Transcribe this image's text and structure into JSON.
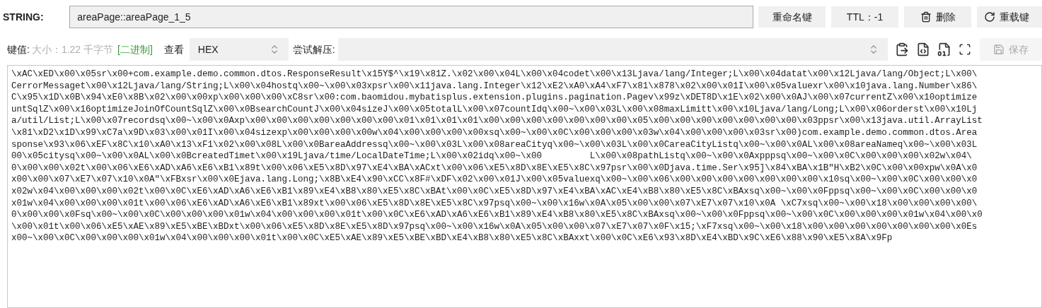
{
  "key_type": "STRING:",
  "key_name": "areaPage::areaPage_1_5",
  "buttons": [
    {
      "kind": "rename",
      "label": "重命名键"
    },
    {
      "kind": "ttl",
      "label": "TTL：-1"
    },
    {
      "kind": "delete",
      "label": "删除"
    },
    {
      "kind": "reload",
      "label": "重载键"
    }
  ],
  "value_bar": {
    "label": "键值:",
    "size": "大小：1.22 千字节",
    "format": "[二进制]",
    "view_label": "查看",
    "view_mode": "HEX",
    "decompress_label": "尝试解压:",
    "save": {
      "label": "保存",
      "disabled": true
    }
  },
  "value_lines": [
    "\\xAC\\xED\\x00\\x05sr\\x00+com.example.demo.common.dtos.ResponseResult\\x15Y$^\\x19\\x81Z.\\x02\\x00\\x04L\\x00\\x04codet\\x00\\x13Ljava/lang/Integer;L\\x00\\x04datat\\x00\\x12Ljava/lang/Object;L\\x00\\",
    "CerrorMessaget\\x00\\x12Ljava/lang/String;L\\x00\\x04hostq\\x00~\\x00\\x03xpsr\\x00\\x11java.lang.Integer\\x12\\xE2\\xA0\\xA4\\xF7\\x81\\x878\\x02\\x00\\x01I\\x00\\x05valuexr\\x00\\x10java.lang.Number\\x86\\",
    "C\\x95\\x1D\\x0B\\x94\\xE0\\x8B\\x02\\x00\\x00xp\\x00\\x00\\x00\\xC8sr\\x00:com.baomidou.mybatisplus.extension.plugins.pagination.Pagev\\x99z\\xDET8D\\x1E\\x02\\x00\\x0AJ\\x00\\x07currentZ\\x00\\x10optimize",
    "untSqlZ\\x00\\x16optimizeJoinOfCountSqlZ\\x00\\x0BsearchCountJ\\x00\\x04sizeJ\\x00\\x05totalL\\x00\\x07countIdq\\x00~\\x00\\x03L\\x00\\x08maxLimitt\\x00\\x10Ljava/lang/Long;L\\x00\\x06orderst\\x00\\x10Lj",
    "a/util/List;L\\x00\\x07recordsq\\x00~\\x00\\x0Axp\\x00\\x00\\x00\\x00\\x00\\x00\\x00\\x01\\x01\\x01\\x01\\x00\\x00\\x00\\x00\\x00\\x00\\x00\\x05\\x00\\x00\\x00\\x00\\x00\\x00\\x00\\x03ppsr\\x00\\x13java.util.ArrayList",
    "\\x81\\xD2\\x1D\\x99\\xC7a\\x9D\\x03\\x00\\x01I\\x00\\x04sizexp\\x00\\x00\\x00\\x00w\\x04\\x00\\x00\\x00\\x00xsq\\x00~\\x00\\x0C\\x00\\x00\\x00\\x03w\\x04\\x00\\x00\\x00\\x03sr\\x00)com.example.demo.common.dtos.Area",
    "sponse\\x93\\x06\\xEF\\x8C\\x10\\xA0\\x13\\xF1\\x02\\x00\\x08L\\x00\\x0BareaAddressq\\x00~\\x00\\x03L\\x00\\x08areaCityq\\x00~\\x00\\x03L\\x00\\x0CareaCityListq\\x00~\\x00\\x0AL\\x00\\x08areaNameq\\x00~\\x00\\x03L",
    "00\\x05citysq\\x00~\\x00\\x0AL\\x00\\x0BcreatedTimet\\x00\\x19Ljava/time/LocalDateTime;L\\x00\\x02idq\\x00~\\x00         L\\x00\\x08pathListq\\x00~\\x00\\x0Axpppsq\\x00~\\x00\\x0C\\x00\\x00\\x00\\x02w\\x04\\",
    "0\\x00\\x00\\x02t\\x00\\x06\\xE6\\xAD\\xA6\\xE6\\xB1\\x89t\\x00\\x06\\xE5\\x8D\\x97\\xE4\\xBA\\xACxt\\x00\\x06\\xE5\\x8D\\x8E\\xE5\\x8C\\x97psr\\x00\\x0Djava.time.Ser\\x95]\\x84\\xBA\\x1B\"H\\xB2\\x0C\\x00\\x00xpw\\x0A\\x0",
    "x00\\x00\\x07\\xE7\\x07\\x10\\x0A\"\\xFBxsr\\x00\\x0Ejava.lang.Long;\\x8B\\xE4\\x90\\xCC\\x8F#\\xDF\\x02\\x00\\x01J\\x00\\x05valuexq\\x00~\\x00\\x06\\x00\\x00\\x00\\x00\\x00\\x00\\x00\\x10sq\\x00~\\x00\\x0C\\x00\\x00\\x0",
    "x02w\\x04\\x00\\x00\\x00\\x02t\\x00\\x0C\\xE6\\xAD\\xA6\\xE6\\xB1\\x89\\xE4\\xB8\\x80\\xE5\\x8C\\xBAt\\x00\\x0C\\xE5\\x8D\\x97\\xE4\\xBA\\xAC\\xE4\\xB8\\x80\\xE5\\x8C\\xBAxsq\\x00~\\x00\\x0Fppsq\\x00~\\x00\\x0C\\x00\\x00\\x0",
    "x01w\\x04\\x00\\x00\\x00\\x01t\\x00\\x06\\xE6\\xAD\\xA6\\xE6\\xB1\\x89xt\\x00\\x06\\xE5\\x8D\\x8E\\xE5\\x8C\\x97psq\\x00~\\x00\\x16w\\x0A\\x05\\x00\\x00\\x07\\xE7\\x07\\x10\\x0A \\xC7xsq\\x00~\\x00\\x18\\x00\\x00\\x00\\x00\\",
    "0\\x00\\x00\\x0Fsq\\x00~\\x00\\x0C\\x00\\x00\\x00\\x01w\\x04\\x00\\x00\\x00\\x01t\\x00\\x0C\\xE6\\xAD\\xA6\\xE6\\xB1\\x89\\xE4\\xB8\\x80\\xE5\\x8C\\xBAxsq\\x00~\\x00\\x0Fppsq\\x00~\\x00\\x0C\\x00\\x00\\x00\\x01w\\x04\\x00\\x0",
    "\\x00\\x01t\\x00\\x06\\xE5\\xAE\\x89\\xE5\\xBE\\xBDxt\\x00\\x06\\xE5\\x8D\\x8E\\xE5\\x8D\\x97psq\\x00~\\x00\\x16w\\x0A\\x05\\x00\\x00\\x07\\xE7\\x07\\x0F\\x15;\\xF7xsq\\x00~\\x00\\x18\\x00\\x00\\x00\\x00\\x00\\x00\\x00\\x0Es",
    "x00~\\x00\\x0C\\x00\\x00\\x00\\x01w\\x04\\x00\\x00\\x00\\x01t\\x00\\x0C\\xE5\\xAE\\x89\\xE5\\xBE\\xBD\\xE4\\xB8\\x80\\xE5\\x8C\\xBAxxt\\x00\\x0C\\xE6\\x93\\x8D\\xE4\\xBD\\x9C\\xE6\\x88\\x90\\xE5\\x8A\\x9Fp"
  ]
}
